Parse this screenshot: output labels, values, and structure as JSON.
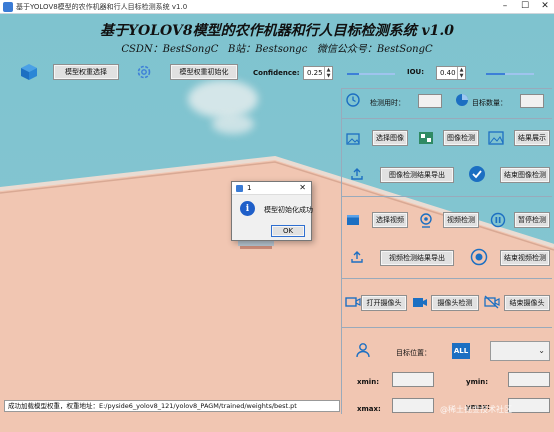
{
  "window": {
    "title": "基于YOLOV8模型的农作机器和行人目标检测系统 v1.0",
    "min": "–",
    "max": "☐",
    "close": "✕"
  },
  "header": {
    "title": "基于YOLOV8模型的农作机器和行人目标检测系统 v1.0",
    "subtitle": "CSDN：BestSongC   B站：Bestsongc   微信公众号：BestSongC"
  },
  "toolbar": {
    "weight_select": "模型权重选择",
    "weight_init": "模型权重初始化",
    "confidence_label": "Confidence:",
    "confidence_value": "0.25",
    "iou_label": "IOU:",
    "iou_value": "0.40"
  },
  "stats": {
    "time_label": "检测用时：",
    "count_label": "目标数量："
  },
  "image_section": {
    "select": "选择图像",
    "detect": "图像检测",
    "show": "结果展示",
    "export": "图像检测结果导出",
    "end": "结束图像检测"
  },
  "video_section": {
    "select": "选择视频",
    "detect": "视频检测",
    "pause": "暂停检测",
    "export": "视频检测结果导出",
    "end": "结束视频检测"
  },
  "camera_section": {
    "open": "打开摄像头",
    "detect": "摄像头检测",
    "end": "结束摄像头"
  },
  "target": {
    "label": "目标位置：",
    "all_badge": "ALL",
    "xmin": "xmin:",
    "ymin": "ymin:",
    "xmax": "xmax:",
    "ymax": "ymax:"
  },
  "dialog": {
    "title": "1",
    "message": "模型初始化成功",
    "ok": "OK",
    "close": "✕",
    "info_glyph": "i"
  },
  "status": {
    "text": "成功加载模型权重，权重地址：E:/pyside6_yolov8_121/yolov8_PAGM/trained/weights/best.pt"
  },
  "watermark": "@稀土掘金技术社区",
  "colors": {
    "accent": "#3d7fd8",
    "sky": "#7fc3cf",
    "wall": "#f2c7b3",
    "roof": "#e9b9a4"
  }
}
